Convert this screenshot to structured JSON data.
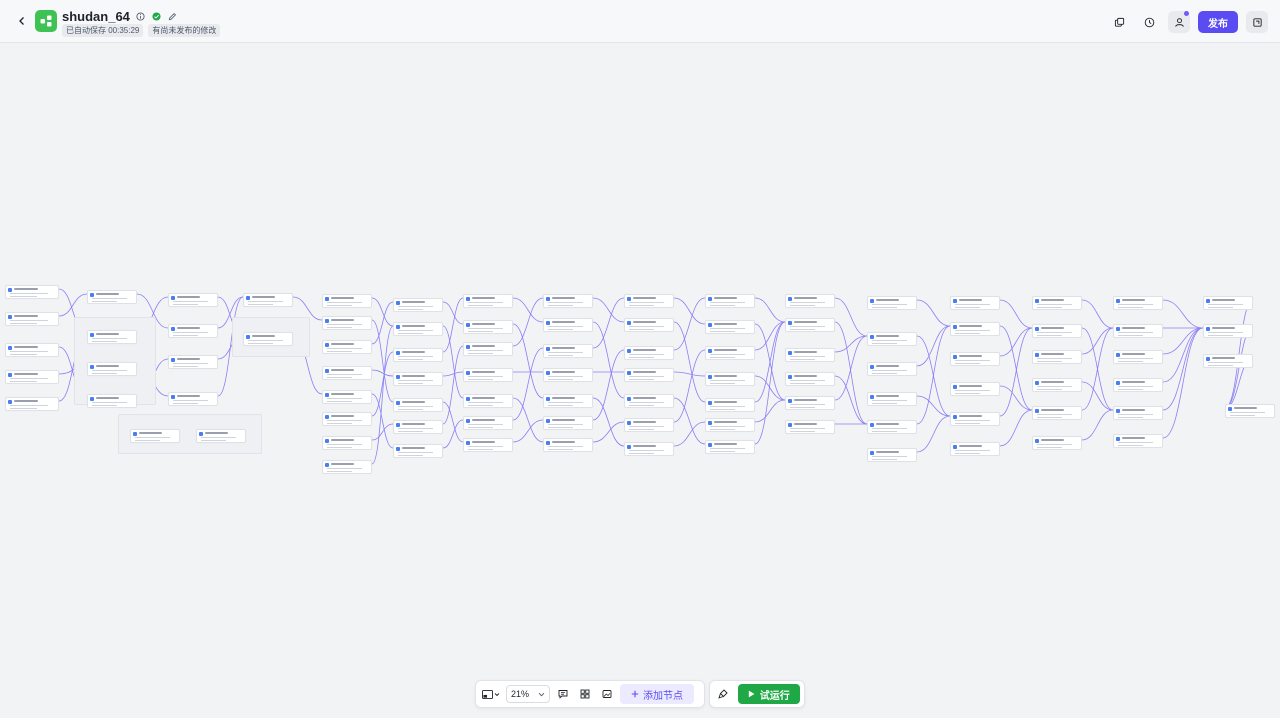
{
  "header": {
    "title": "shudan_64",
    "autosave": "已自动保存 00:35:29",
    "unpublished": "有尚未发布的修改",
    "publish_label": "发布",
    "icons": [
      "back-icon",
      "app-logo-icon",
      "info-icon",
      "verified-icon",
      "edit-icon",
      "copy-icon",
      "history-icon",
      "collaborator-icon",
      "more-icon"
    ],
    "colors": {
      "brand": "#5a4cf2",
      "logo": "#3ec254",
      "verified": "#1fa845"
    }
  },
  "canvas": {
    "description_free": true
  },
  "toolbar": {
    "zoom": "21%",
    "add_node_label": "添加节点",
    "run_label": "试运行",
    "icons": [
      "minimap-icon",
      "chevron-down-icon",
      "comment-icon",
      "grid-icon",
      "image-icon",
      "plus-icon",
      "brush-icon",
      "play-icon"
    ],
    "colors": {
      "run": "#1fa845",
      "add_node_bg": "#ebeafe"
    }
  }
}
